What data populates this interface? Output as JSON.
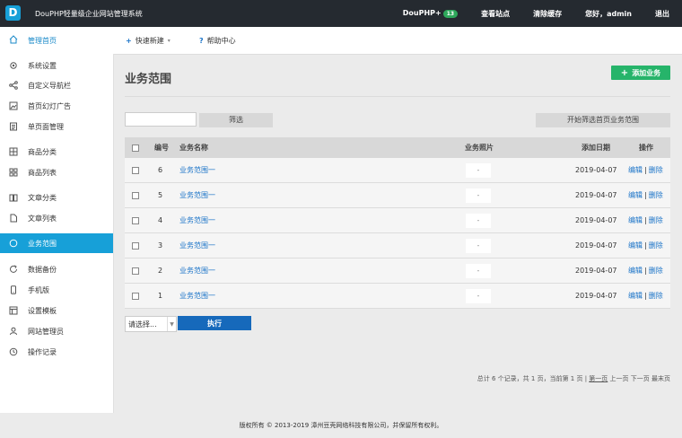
{
  "topbar": {
    "logo_text": "D",
    "system_name": "DouPHP轻量级企业网站管理系统",
    "douphp_label": "DouPHP+",
    "douphp_badge": "13",
    "view_site": "查看站点",
    "clear_cache": "清除缓存",
    "greeting": "您好，admin",
    "logout": "退出"
  },
  "subbar": {
    "home_label": "管理首页",
    "quick_new": "快速新建",
    "help_center": "帮助中心"
  },
  "sidebar": {
    "items": [
      {
        "label": "系统设置",
        "icon": "gear-icon"
      },
      {
        "label": "自定义导航栏",
        "icon": "share-icon"
      },
      {
        "label": "首页幻灯广告",
        "icon": "image-icon"
      },
      {
        "label": "单页面管理",
        "icon": "document-icon"
      },
      {
        "label": "商品分类",
        "icon": "grid-icon"
      },
      {
        "label": "商品列表",
        "icon": "apps-icon"
      },
      {
        "label": "文章分类",
        "icon": "book-icon"
      },
      {
        "label": "文章列表",
        "icon": "file-icon"
      },
      {
        "label": "业务范围",
        "icon": "circle-icon"
      },
      {
        "label": "数据备份",
        "icon": "refresh-icon"
      },
      {
        "label": "手机版",
        "icon": "mobile-icon"
      },
      {
        "label": "设置模板",
        "icon": "template-icon"
      },
      {
        "label": "网站管理员",
        "icon": "user-icon"
      },
      {
        "label": "操作记录",
        "icon": "clock-icon"
      }
    ]
  },
  "main": {
    "title": "业务范围",
    "add_button": "添加业务",
    "filter_input_value": "",
    "filter_button": "筛选",
    "home_filter_button": "开始筛选首页业务范围",
    "columns": [
      "编号",
      "业务名称",
      "业务照片",
      "添加日期",
      "操作"
    ],
    "rows": [
      {
        "id": "6",
        "name": "业务范围一",
        "photo": "-",
        "date": "2019-04-07",
        "edit": "编辑",
        "delete": "删除"
      },
      {
        "id": "5",
        "name": "业务范围一",
        "photo": "-",
        "date": "2019-04-07",
        "edit": "编辑",
        "delete": "删除"
      },
      {
        "id": "4",
        "name": "业务范围一",
        "photo": "-",
        "date": "2019-04-07",
        "edit": "编辑",
        "delete": "删除"
      },
      {
        "id": "3",
        "name": "业务范围一",
        "photo": "-",
        "date": "2019-04-07",
        "edit": "编辑",
        "delete": "删除"
      },
      {
        "id": "2",
        "name": "业务范围一",
        "photo": "-",
        "date": "2019-04-07",
        "edit": "编辑",
        "delete": "删除"
      },
      {
        "id": "1",
        "name": "业务范围一",
        "photo": "-",
        "date": "2019-04-07",
        "edit": "编辑",
        "delete": "删除"
      }
    ],
    "batch_select": "请选择...",
    "execute_button": "执行",
    "pagination": {
      "summary": "总计 6 个记录，共 1 页，当前第 1 页 |",
      "first": "第一页",
      "prev": "上一页",
      "next": "下一页",
      "last": "最末页"
    }
  },
  "footer": {
    "copyright": "版权所有 © 2013-2019 漳州豆壳网络科技有限公司，并保留所有权利。"
  },
  "colors": {
    "topbar_bg": "#252a30",
    "accent": "#17a0d8",
    "add_green": "#26b46a",
    "execute_blue": "#1669bb",
    "link_blue": "#1a73c8"
  }
}
